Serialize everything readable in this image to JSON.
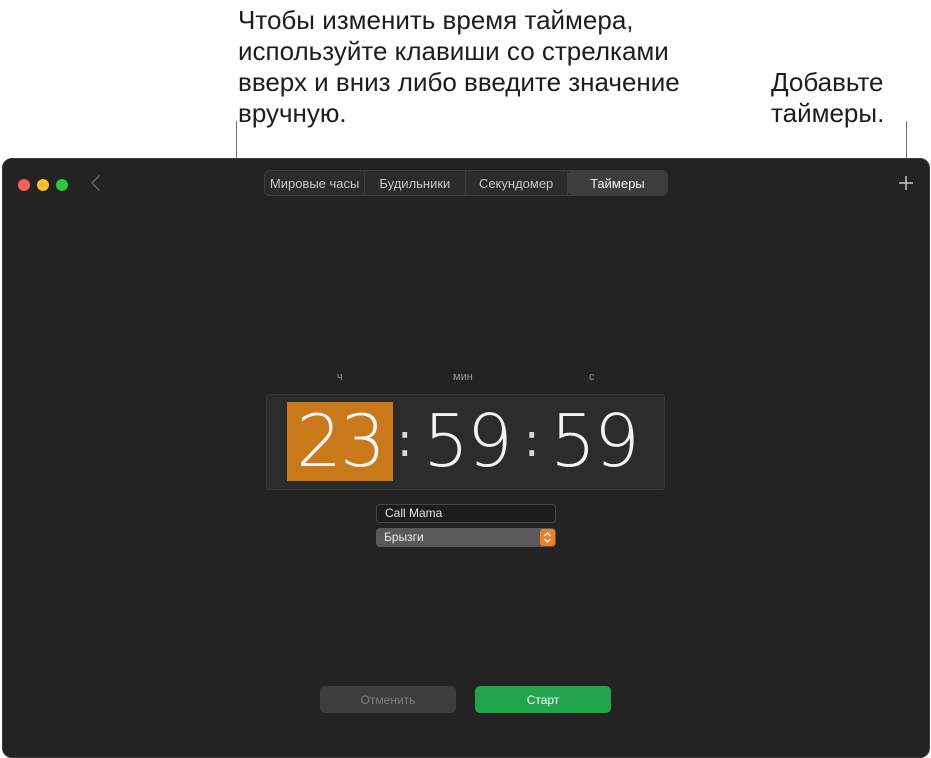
{
  "annotations": {
    "left": "Чтобы изменить время таймера, используйте клавиши со стрелками вверх и вниз либо введите значение вручную.",
    "right": "Добавьте таймеры."
  },
  "tabs": [
    {
      "label": "Мировые часы",
      "active": false
    },
    {
      "label": "Будильники",
      "active": false
    },
    {
      "label": "Секундомер",
      "active": false
    },
    {
      "label": "Таймеры",
      "active": true
    }
  ],
  "toolbar": {
    "add_icon": "plus-icon",
    "back_icon": "chevron-left-icon"
  },
  "timer": {
    "unit_hours": "ч",
    "unit_minutes": "мин",
    "unit_seconds": "с",
    "hours": "23",
    "minutes": "59",
    "seconds": "59",
    "separator": ":"
  },
  "label_field": {
    "value": "Call Mama"
  },
  "sound_select": {
    "value": "Брызги"
  },
  "buttons": {
    "cancel": "Отменить",
    "start": "Старт"
  },
  "colors": {
    "selected_digits": "#c9791a",
    "start_button": "#22a54a",
    "select_accent": "#e8822a",
    "window_bg": "#232323"
  }
}
